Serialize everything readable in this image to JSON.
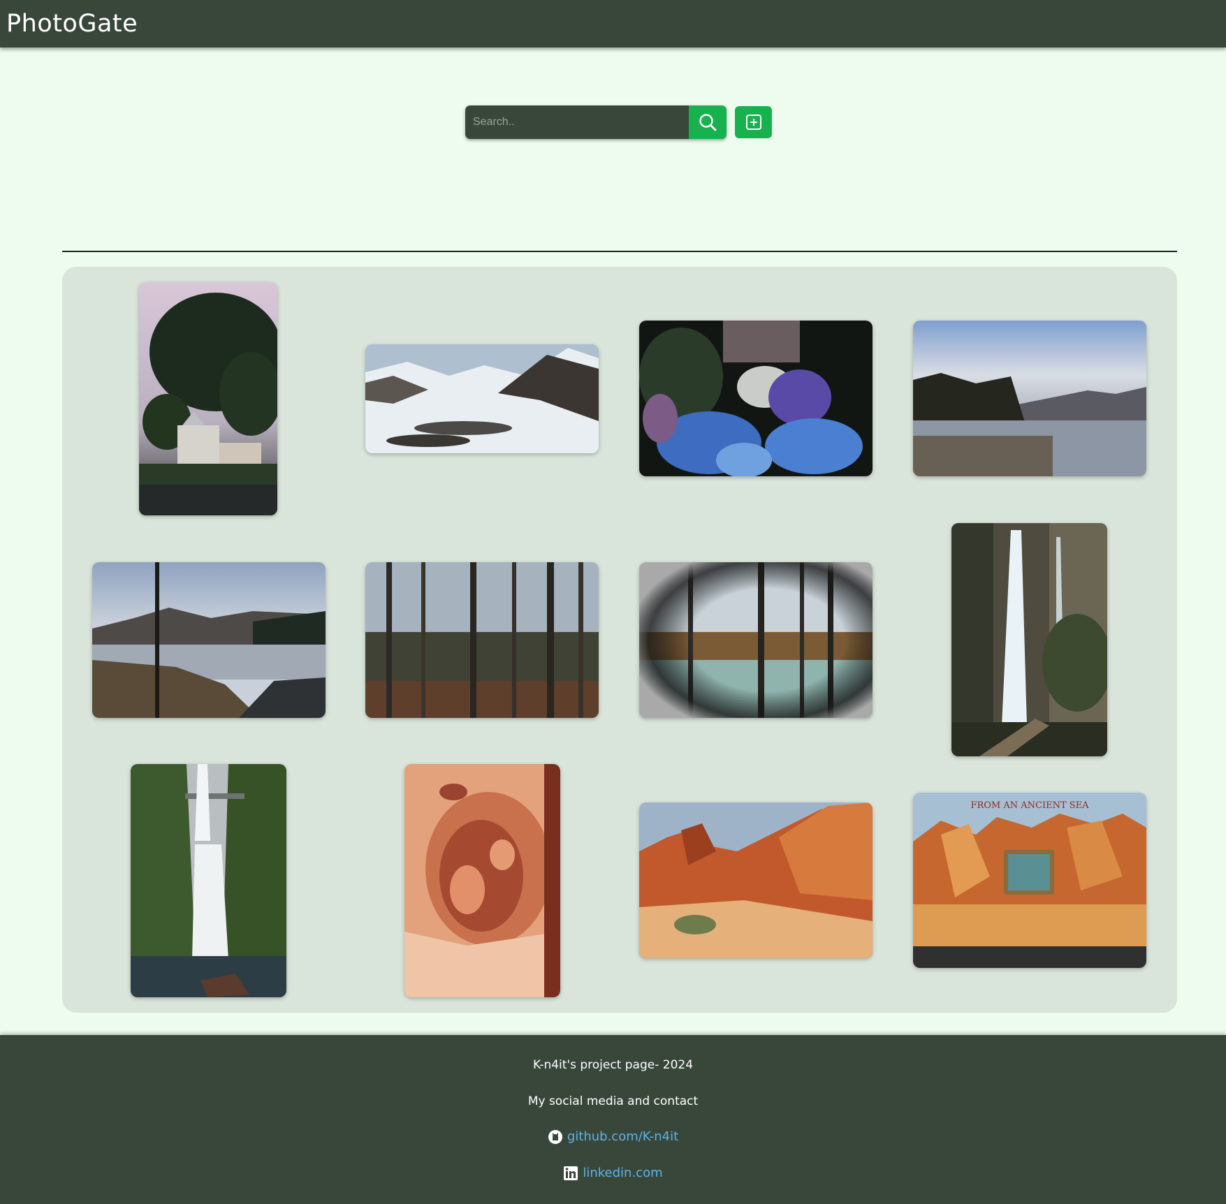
{
  "header": {
    "title": "PhotoGate"
  },
  "search": {
    "placeholder": "Search..",
    "value": ""
  },
  "colors": {
    "header_bg": "#39473b",
    "accent": "#17b24e",
    "page_bg": "#eefcef",
    "gallery_bg": "#d9e4da",
    "link": "#5ab4e8"
  },
  "icons": {
    "search_button": "search-icon",
    "add_button": "plus-square-icon",
    "github": "github-icon",
    "linkedin": "linkedin-icon"
  },
  "gallery": {
    "photos": [
      {
        "subject": "tree-house"
      },
      {
        "subject": "snowy-mountains"
      },
      {
        "subject": "hydrangea-flowers"
      },
      {
        "subject": "lake-shore"
      },
      {
        "subject": "lake-path"
      },
      {
        "subject": "forest"
      },
      {
        "subject": "vignette-pond"
      },
      {
        "subject": "waterfall-path"
      },
      {
        "subject": "waterfall-bridge"
      },
      {
        "subject": "sandstone-hole"
      },
      {
        "subject": "red-rocks"
      },
      {
        "subject": "ancient-sea-sign"
      }
    ]
  },
  "footer": {
    "project": "K-n4it's project page- 2024",
    "social_heading": "My social media and contact",
    "github_link": "github.com/K-n4it",
    "linkedin_link": "linkedin.com"
  }
}
